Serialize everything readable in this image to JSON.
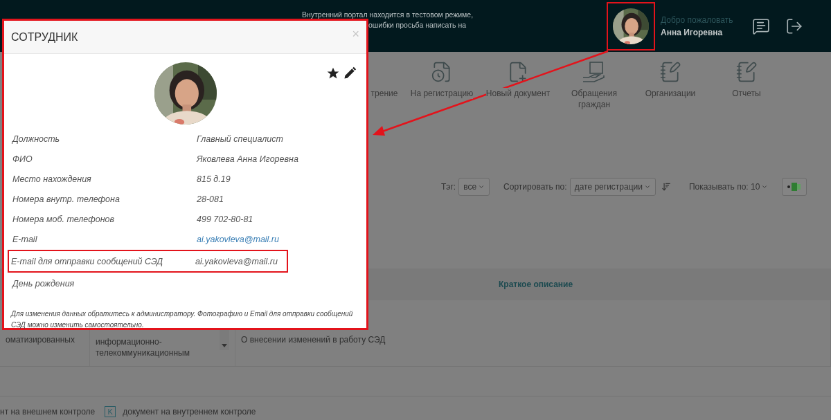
{
  "header": {
    "notice_lines": [
      "Внутренний портал находится в тестовом режиме,",
      "ошибки просьба написать на"
    ],
    "greeting": "Добро пожаловать",
    "user_name": "Анна Игоревна"
  },
  "nav": [
    {
      "label": "трение",
      "kind": "hidden"
    },
    {
      "label": "На регистрацию",
      "kind": "clock-doc"
    },
    {
      "label": "Новый документ",
      "kind": "plus-doc"
    },
    {
      "label": "Обращения\nграждан",
      "kind": "hand"
    },
    {
      "label": "Организации",
      "kind": "list-pen"
    },
    {
      "label": "Отчеты",
      "kind": "list-pen"
    }
  ],
  "toolbar": {
    "tag_label": "Тэг:",
    "tag_value": "все",
    "sort_label": "Сортировать по:",
    "sort_value": "дате регистрации",
    "page_size": "Показывать по: 10"
  },
  "table": {
    "header": "Краткое описание",
    "rows": [
      {
        "cells": [
          "оматизированных",
          "информационно-\nтелекоммуникационным",
          "О внесении изменений в работу СЭД"
        ]
      }
    ]
  },
  "legend": [
    {
      "label": "нт на внешнем контроле"
    },
    {
      "marker": "K",
      "label": "документ на внутреннем контроле"
    }
  ],
  "dialog": {
    "title": "СОТРУДНИК",
    "close": "×",
    "fields": [
      {
        "label": "Должность",
        "value": "Главный специалист",
        "kind": "text",
        "highlighted": false
      },
      {
        "label": "ФИО",
        "value": "Яковлева Анна Игоревна",
        "kind": "text",
        "highlighted": false
      },
      {
        "label": "Место нахождения",
        "value": "815 д.19",
        "kind": "text",
        "highlighted": false
      },
      {
        "label": "Номера внутр. телефона",
        "value": "28-081",
        "kind": "text",
        "highlighted": false
      },
      {
        "label": "Номера моб. телефонов",
        "value": "499 702-80-81",
        "kind": "text",
        "highlighted": false
      },
      {
        "label": "E-mail",
        "value": "ai.yakovleva@mail.ru",
        "kind": "link",
        "highlighted": false
      },
      {
        "label": "E-mail для отправки сообщений СЭД",
        "value": "ai.yakovleva@mail.ru",
        "kind": "text",
        "highlighted": true
      },
      {
        "label": "День рождения",
        "kind": "empty",
        "highlighted": false
      }
    ],
    "note": "Для изменения данных обратитесь к администратору. Фотографию и Email для отправки сообщений СЭД можно изменить самостоятельно."
  }
}
